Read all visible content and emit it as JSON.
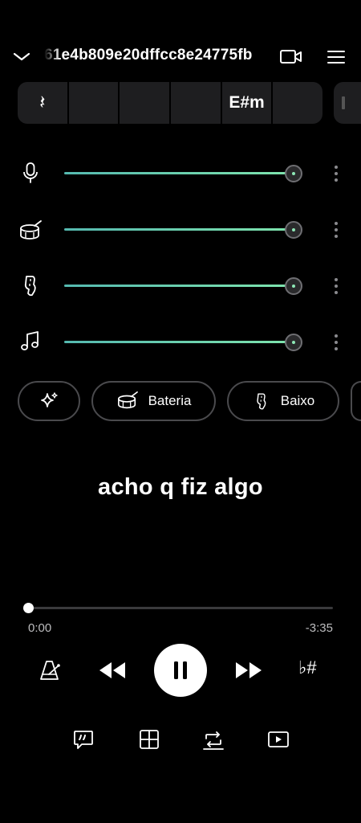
{
  "header": {
    "title": "61e4b809e20dffcc8e24775fb",
    "icons": [
      "chevron-down-icon",
      "video-camera-icon",
      "menu-icon"
    ]
  },
  "chords": {
    "cells": [
      "𝄽",
      "",
      "",
      "",
      "E#m",
      ""
    ]
  },
  "tracks": [
    {
      "name": "vocals",
      "icon": "microphone-icon",
      "level": 1.0
    },
    {
      "name": "drums",
      "icon": "drum-icon",
      "level": 1.0
    },
    {
      "name": "bass",
      "icon": "bass-guitar-icon",
      "level": 1.0
    },
    {
      "name": "other",
      "icon": "music-note-icon",
      "level": 1.0
    }
  ],
  "chips": [
    {
      "icon": "sparkles-icon",
      "label": ""
    },
    {
      "icon": "drum-icon",
      "label": "Bateria"
    },
    {
      "icon": "bass-guitar-icon",
      "label": "Baixo"
    }
  ],
  "lyric": "acho q fiz algo",
  "player": {
    "elapsed": "0:00",
    "remaining": "-3:35",
    "progress": 0.0,
    "sharp_flat_label": "♭#"
  },
  "toolbar": [
    "lyrics-quote-icon",
    "grid-icon",
    "loop-icon",
    "video-play-icon"
  ],
  "colors": {
    "background": "#000000",
    "slider_start": "#55b9b0",
    "slider_end": "#7fe5ad",
    "surface": "#1e1e20"
  }
}
